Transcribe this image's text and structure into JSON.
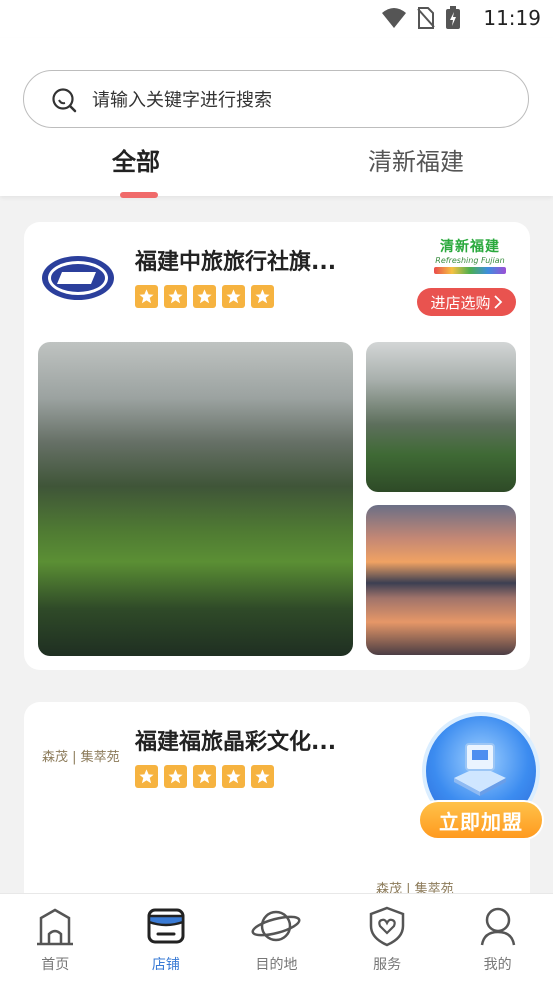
{
  "status_bar": {
    "time": "11:19"
  },
  "search": {
    "placeholder": "请输入关键字进行搜索"
  },
  "tabs": [
    {
      "label": "全部",
      "active": true
    },
    {
      "label": "清新福建",
      "active": false
    }
  ],
  "stores": [
    {
      "name": "福建中旅旅行社旗...",
      "logo": "CTS",
      "rating": 5,
      "badge_title": "清新福建",
      "badge_subtitle": "Refreshing Fujian",
      "button": "进店选购"
    },
    {
      "name": "福建福旅晶彩文化...",
      "logo": "森茂 | 集萃苑",
      "rating": 5
    }
  ],
  "floating": {
    "label": "立即加盟"
  },
  "bottom_nav": [
    {
      "label": "首页",
      "icon": "home-icon",
      "active": false
    },
    {
      "label": "店铺",
      "icon": "store-icon",
      "active": true
    },
    {
      "label": "目的地",
      "icon": "planet-icon",
      "active": false
    },
    {
      "label": "服务",
      "icon": "shield-icon",
      "active": false
    },
    {
      "label": "我的",
      "icon": "user-icon",
      "active": false
    }
  ],
  "colors": {
    "accent": "#e9534f",
    "active_nav": "#3a7bd5",
    "star": "#f6b340",
    "join_button": "#ff9a1f"
  }
}
